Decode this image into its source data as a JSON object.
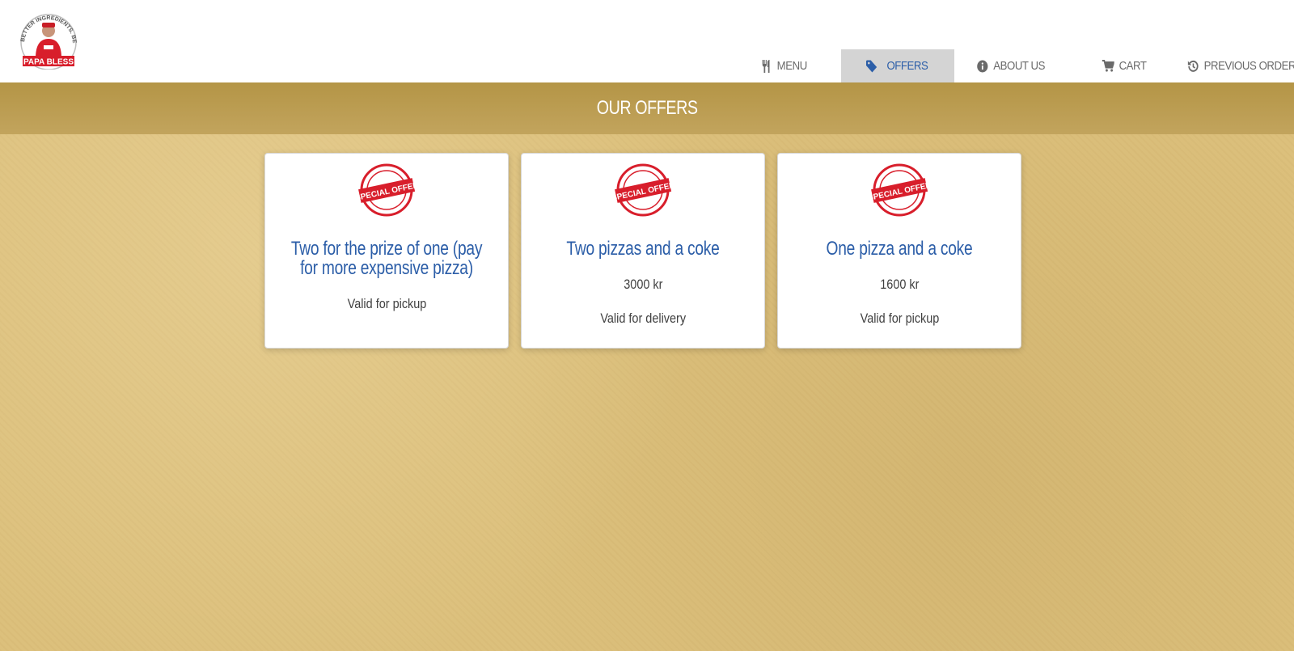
{
  "brand": {
    "name": "PAPA BLESS",
    "tagline": "BETTER INGREDIENTS. BETTER PIZZA",
    "colors": {
      "red": "#d81e2b",
      "blue": "#2c5ea8"
    }
  },
  "nav": {
    "items": [
      {
        "label": "MENU",
        "icon": "cutlery-icon"
      },
      {
        "label": "OFFERS",
        "icon": "tag-icon",
        "active": true
      },
      {
        "label": "ABOUT US",
        "icon": "info-icon"
      },
      {
        "label": "CART",
        "icon": "cart-icon"
      },
      {
        "label": "PREVIOUS ORDERS",
        "icon": "history-icon"
      }
    ]
  },
  "page": {
    "title": "OUR OFFERS"
  },
  "offers": [
    {
      "badge": "SPECIAL OFFER",
      "title": "Two for the prize of one (pay for more expensive pizza)",
      "price": "",
      "validity": "Valid for pickup"
    },
    {
      "badge": "SPECIAL OFFER",
      "title": "Two pizzas and a coke",
      "price": "3000 kr",
      "validity": "Valid for delivery"
    },
    {
      "badge": "SPECIAL OFFER",
      "title": "One pizza and a coke",
      "price": "1600 kr",
      "validity": "Valid for pickup"
    }
  ]
}
